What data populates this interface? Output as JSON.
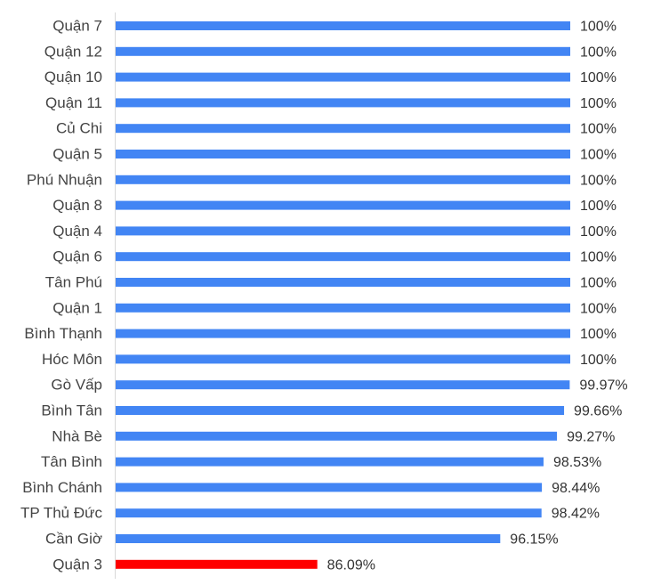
{
  "chart_data": {
    "type": "bar",
    "orientation": "horizontal",
    "title": "",
    "xlabel": "",
    "ylabel": "",
    "xlim": [
      75,
      100
    ],
    "grid": false,
    "legend": "none",
    "value_format": "percent",
    "colors": {
      "default": "#4285f4",
      "highlight": "#ff0000",
      "axis": "#d9d9d9"
    },
    "categories": [
      "Quận 7",
      "Quận 12",
      "Quận 10",
      "Quận 11",
      "Củ Chi",
      "Quận 5",
      "Phú Nhuận",
      "Quận 8",
      "Quận 4",
      "Quận 6",
      "Tân Phú",
      "Quận 1",
      "Bình Thạnh",
      "Hóc Môn",
      "Gò Vấp",
      "Bình Tân",
      "Nhà Bè",
      "Tân Bình",
      "Bình Chánh",
      "TP Thủ Đức",
      "Cần Giờ",
      "Quận 3"
    ],
    "values": [
      100,
      100,
      100,
      100,
      100,
      100,
      100,
      100,
      100,
      100,
      100,
      100,
      100,
      100,
      99.97,
      99.66,
      99.27,
      98.53,
      98.44,
      98.42,
      96.15,
      86.09
    ],
    "value_labels": [
      "100%",
      "100%",
      "100%",
      "100%",
      "100%",
      "100%",
      "100%",
      "100%",
      "100%",
      "100%",
      "100%",
      "100%",
      "100%",
      "100%",
      "99.97%",
      "99.66%",
      "99.27%",
      "98.53%",
      "98.44%",
      "98.42%",
      "96.15%",
      "86.09%"
    ],
    "highlight_index": 21
  }
}
